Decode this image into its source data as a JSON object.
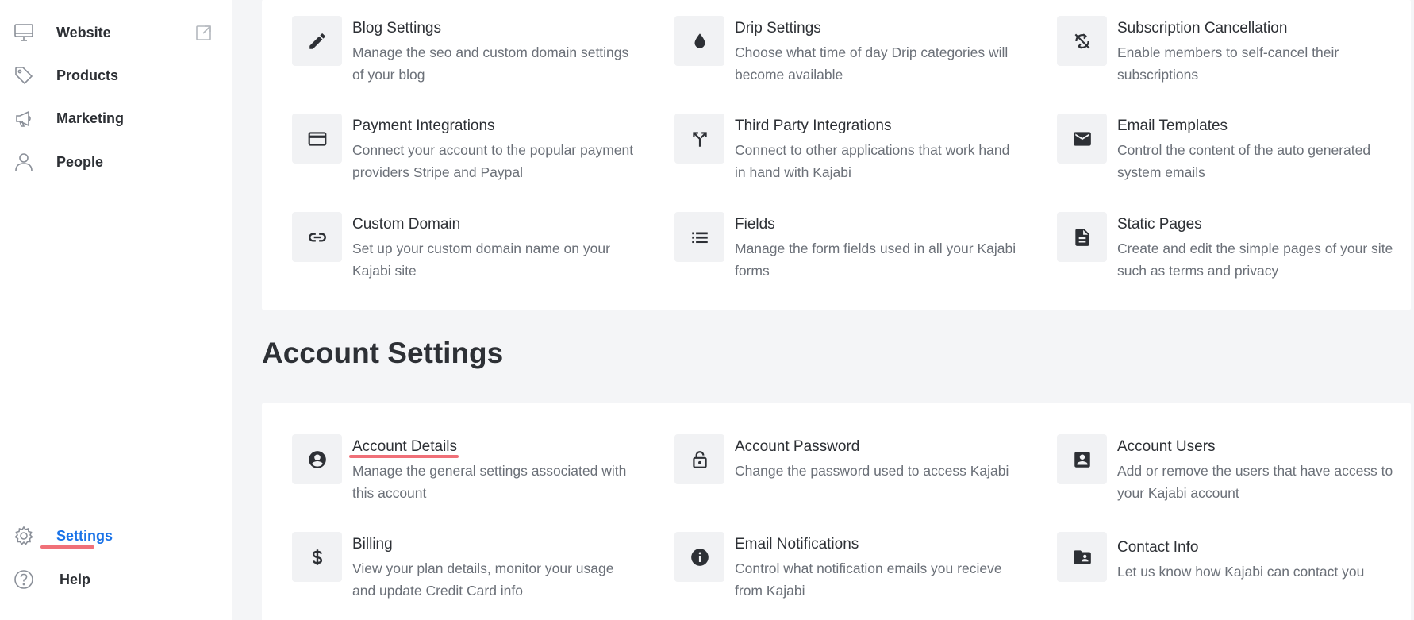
{
  "sidebar": {
    "items": [
      {
        "label": "Website",
        "icon": "monitor-icon"
      },
      {
        "label": "Products",
        "icon": "tag-icon"
      },
      {
        "label": "Marketing",
        "icon": "megaphone-icon"
      },
      {
        "label": "People",
        "icon": "person-icon"
      }
    ],
    "bottom": [
      {
        "label": "Settings",
        "icon": "gear-icon",
        "active": true
      },
      {
        "label": "Help",
        "icon": "help-circle-icon"
      }
    ],
    "accent_color": "#1a73e8"
  },
  "site_settings": {
    "items": [
      {
        "title": "Blog Settings",
        "desc": "Manage the seo and custom domain settings of your blog",
        "icon": "pencil-icon"
      },
      {
        "title": "Drip Settings",
        "desc": "Choose what time of day Drip categories will become available",
        "icon": "drop-icon"
      },
      {
        "title": "Subscription Cancellation",
        "desc": "Enable members to self-cancel their subscriptions",
        "icon": "sync-disabled-icon"
      },
      {
        "title": "Payment Integrations",
        "desc": "Connect your account to the popular payment providers Stripe and Paypal",
        "icon": "credit-card-icon"
      },
      {
        "title": "Third Party Integrations",
        "desc": "Connect to other applications that work hand in hand with Kajabi",
        "icon": "merge-icon"
      },
      {
        "title": "Email Templates",
        "desc": "Control the content of the auto generated system emails",
        "icon": "envelope-icon"
      },
      {
        "title": "Custom Domain",
        "desc": "Set up your custom domain name on your Kajabi site",
        "icon": "link-icon"
      },
      {
        "title": "Fields",
        "desc": "Manage the form fields used in all your Kajabi forms",
        "icon": "list-icon"
      },
      {
        "title": "Static Pages",
        "desc": "Create and edit the simple pages of your site such as terms and privacy",
        "icon": "document-icon"
      }
    ]
  },
  "account_settings": {
    "title": "Account Settings",
    "items": [
      {
        "title": "Account Details",
        "desc": "Manage the general settings associated with this account",
        "icon": "account-circle-icon"
      },
      {
        "title": "Account Password",
        "desc": "Change the password used to access Kajabi",
        "icon": "unlock-icon"
      },
      {
        "title": "Account Users",
        "desc": "Add or remove the users that have access to your Kajabi account",
        "icon": "account-box-icon"
      },
      {
        "title": "Billing",
        "desc": "View your plan details, monitor your usage and update Credit Card info",
        "icon": "dollar-icon"
      },
      {
        "title": "Email Notifications",
        "desc": "Control what notification emails you recieve from Kajabi",
        "icon": "info-icon"
      },
      {
        "title": "Contact Info",
        "desc": "Let us know how Kajabi can contact you",
        "icon": "contact-folder-icon"
      }
    ]
  },
  "highlight_color": "#f07078"
}
